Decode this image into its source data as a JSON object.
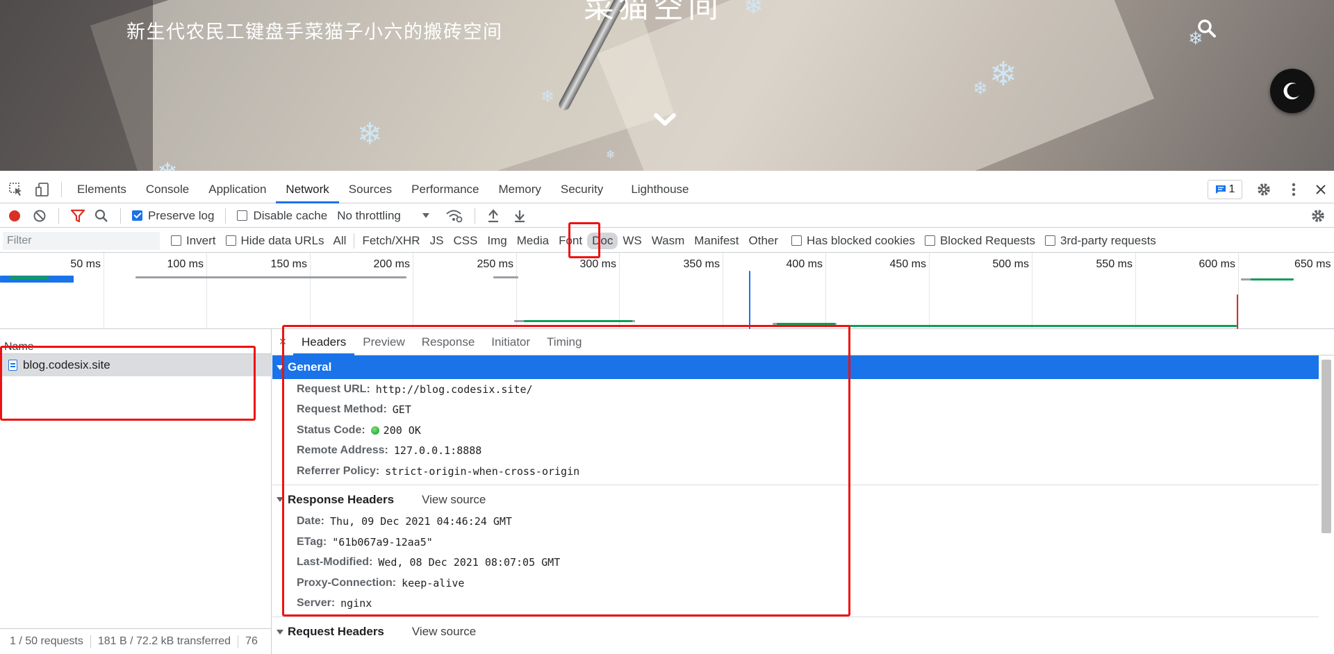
{
  "banner": {
    "site_title": "菜猫空间",
    "site_subtitle": "新生代农民工键盘手菜猫子小六的搬砖空间"
  },
  "devtools_tabs": [
    "Elements",
    "Console",
    "Application",
    "Network",
    "Sources",
    "Performance",
    "Memory",
    "Security",
    "Lighthouse"
  ],
  "active_tab": "Network",
  "issues_count": "1",
  "toolbar": {
    "preserve_log": "Preserve log",
    "disable_cache": "Disable cache",
    "throttling": "No throttling"
  },
  "filter": {
    "placeholder": "Filter",
    "invert": "Invert",
    "hide_data_urls": "Hide data URLs",
    "types": [
      "All",
      "Fetch/XHR",
      "JS",
      "CSS",
      "Img",
      "Media",
      "Font",
      "Doc",
      "WS",
      "Wasm",
      "Manifest",
      "Other"
    ],
    "selected_type": "Doc",
    "has_blocked_cookies": "Has blocked cookies",
    "blocked_requests": "Blocked Requests",
    "third_party": "3rd-party requests"
  },
  "overview": {
    "ticks": [
      "50 ms",
      "100 ms",
      "150 ms",
      "200 ms",
      "250 ms",
      "300 ms",
      "350 ms",
      "400 ms",
      "450 ms",
      "500 ms",
      "550 ms",
      "600 ms",
      "650 ms"
    ]
  },
  "request_list": {
    "header": "Name",
    "requests": [
      "blog.codesix.site"
    ]
  },
  "details": {
    "tabs": [
      "Headers",
      "Preview",
      "Response",
      "Initiator",
      "Timing"
    ],
    "active_tab": "Headers",
    "general": {
      "title": "General",
      "rows": [
        {
          "key": "Request URL:",
          "value": "http://blog.codesix.site/"
        },
        {
          "key": "Request Method:",
          "value": "GET"
        },
        {
          "key": "Status Code:",
          "value": "200 OK"
        },
        {
          "key": "Remote Address:",
          "value": "127.0.0.1:8888"
        },
        {
          "key": "Referrer Policy:",
          "value": "strict-origin-when-cross-origin"
        }
      ]
    },
    "response_headers": {
      "title": "Response Headers",
      "view_source": "View source",
      "rows": [
        {
          "key": "Date:",
          "value": "Thu, 09 Dec 2021 04:46:24 GMT"
        },
        {
          "key": "ETag:",
          "value": "\"61b067a9-12aa5\""
        },
        {
          "key": "Last-Modified:",
          "value": "Wed, 08 Dec 2021 08:07:05 GMT"
        },
        {
          "key": "Proxy-Connection:",
          "value": "keep-alive"
        },
        {
          "key": "Server:",
          "value": "nginx"
        }
      ]
    },
    "request_headers": {
      "title": "Request Headers",
      "view_source": "View source"
    }
  },
  "status_bar": {
    "requests": "1 / 50 requests",
    "transferred": "181 B / 72.2 kB transferred",
    "extra": "76"
  },
  "colors": {
    "accent": "#1a73e8",
    "annotation": "#ee1111",
    "record": "#d93025"
  }
}
